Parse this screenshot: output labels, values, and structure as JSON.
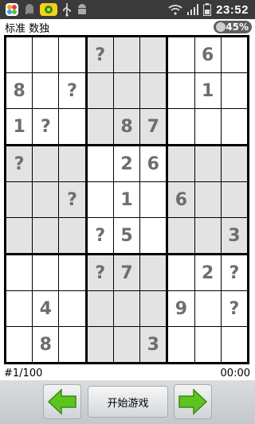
{
  "status_bar": {
    "time": "23:52",
    "icons_left": [
      "app-center-icon",
      "ghost-icon",
      "game-icon",
      "usb-icon",
      "android-icon"
    ],
    "icons_right": [
      "wifi-icon",
      "signal-icon",
      "battery-icon"
    ]
  },
  "title": "标准 数独",
  "battery_badge": "45%",
  "grid": [
    [
      "",
      "",
      "",
      "?",
      "",
      "",
      "",
      "6",
      ""
    ],
    [
      "8",
      "",
      "?",
      "",
      "",
      "",
      "",
      "1",
      ""
    ],
    [
      "1",
      "?",
      "",
      "",
      "8",
      "7",
      "",
      "",
      ""
    ],
    [
      "?",
      "",
      "",
      "",
      "2",
      "6",
      "",
      "",
      ""
    ],
    [
      "",
      "",
      "?",
      "",
      "1",
      "",
      "6",
      "",
      ""
    ],
    [
      "",
      "",
      "",
      "?",
      "5",
      "",
      "",
      "",
      "3"
    ],
    [
      "",
      "",
      "",
      "?",
      "7",
      "",
      "",
      "2",
      "?"
    ],
    [
      "",
      "4",
      "",
      "",
      "",
      "",
      "9",
      "",
      "?"
    ],
    [
      "",
      "8",
      "",
      "",
      "",
      "3",
      "",
      "",
      ""
    ]
  ],
  "shaded_boxes": [
    [
      0,
      1
    ],
    [
      1,
      0
    ],
    [
      1,
      2
    ],
    [
      2,
      1
    ]
  ],
  "colors": {
    "shade": "#e3e3e3",
    "cell": "#ffffff",
    "digit": "#6e6e6e",
    "arrow": "#5cc41f"
  },
  "footer": {
    "puzzle_index": "#1/100",
    "timer": "00:00"
  },
  "controls": {
    "start_label": "开始游戏"
  }
}
